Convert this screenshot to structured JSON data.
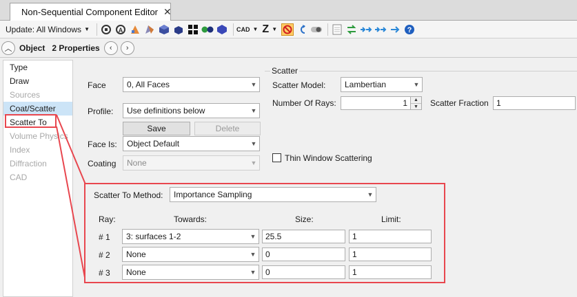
{
  "window": {
    "tab_title": "Non-Sequential Component Editor",
    "close_glyph": "✕"
  },
  "toolbar": {
    "update_label": "Update: All Windows",
    "cad_label": "CAD",
    "z_label": "Z",
    "icons": [
      "refresh-icon",
      "refresh-all-icon",
      "layout-icon",
      "solid-icon",
      "cube-icon",
      "cube-small-icon",
      "grid-icon",
      "two-dots-icon",
      "hexagon-icon",
      "cad-icon",
      "zoom-z-icon",
      "ignore-icon",
      "undo-icon",
      "toggle-icon",
      "sheet-icon",
      "exchange-icon",
      "right-arrows-icon",
      "right-arrows-2-icon",
      "right-arrow-icon",
      "help-icon"
    ]
  },
  "object_bar": {
    "object_label": "Object",
    "properties_label": "2 Properties"
  },
  "nav": {
    "items": [
      {
        "label": "Type",
        "state": "normal"
      },
      {
        "label": "Draw",
        "state": "normal"
      },
      {
        "label": "Sources",
        "state": "disabled"
      },
      {
        "label": "Coat/Scatter",
        "state": "selected"
      },
      {
        "label": "Scatter To",
        "state": "normal"
      },
      {
        "label": "Volume Physics",
        "state": "disabled"
      },
      {
        "label": "Index",
        "state": "disabled"
      },
      {
        "label": "Diffraction",
        "state": "disabled"
      },
      {
        "label": "CAD",
        "state": "disabled"
      }
    ]
  },
  "coat": {
    "face_label": "Face",
    "face_value": "0, All Faces",
    "profile_label": "Profile:",
    "profile_value": "Use definitions below",
    "save_label": "Save",
    "delete_label": "Delete",
    "face_is_label": "Face Is:",
    "face_is_value": "Object Default",
    "coating_label": "Coating",
    "coating_value": "None"
  },
  "scatter": {
    "group_label": "Scatter",
    "model_label": "Scatter Model:",
    "model_value": "Lambertian",
    "rays_label": "Number Of Rays:",
    "rays_value": "1",
    "fraction_label": "Scatter Fraction",
    "fraction_value": "1",
    "thin_window_label": "Thin Window Scattering"
  },
  "scatter_to": {
    "method_label": "Scatter To Method:",
    "method_value": "Importance Sampling",
    "headers": {
      "ray": "Ray:",
      "towards": "Towards:",
      "size": "Size:",
      "limit": "Limit:"
    },
    "rows": [
      {
        "ray": "# 1",
        "towards": "3: surfaces 1-2",
        "size": "25.5",
        "limit": "1"
      },
      {
        "ray": "# 2",
        "towards": "None",
        "size": "0",
        "limit": "1"
      },
      {
        "ray": "# 3",
        "towards": "None",
        "size": "0",
        "limit": "1"
      }
    ]
  },
  "colors": {
    "highlight": "#e8464e",
    "selection": "#cce4f7",
    "ignore_button": "#ffcc66"
  }
}
